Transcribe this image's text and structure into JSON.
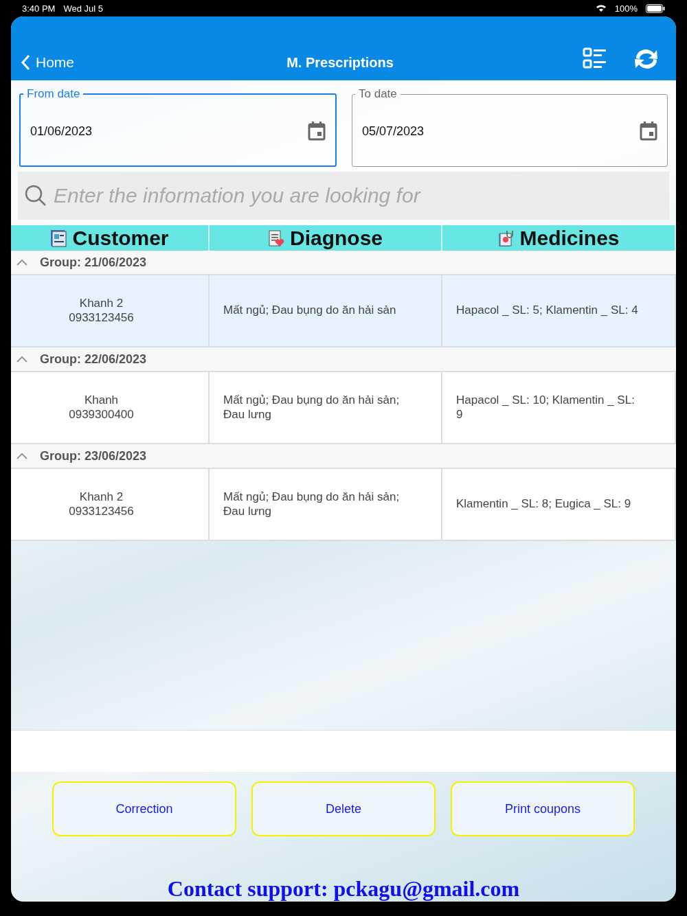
{
  "status_bar": {
    "time": "3:40 PM",
    "date": "Wed Jul 5",
    "battery": "100%"
  },
  "nav": {
    "back": "Home",
    "title": "M. Prescriptions"
  },
  "date_fields": [
    {
      "label": "From date",
      "value": "01/06/2023",
      "focused": true
    },
    {
      "label": "To date",
      "value": "05/07/2023",
      "focused": false
    }
  ],
  "search": {
    "placeholder": "Enter the information you are looking for"
  },
  "table": {
    "columns": [
      {
        "label": "Customer",
        "kind": "customer"
      },
      {
        "label": "Diagnose",
        "kind": "diagnose"
      },
      {
        "label": "Medicines",
        "kind": "medicines"
      }
    ],
    "groups": [
      {
        "label": "Group: 21/06/2023",
        "expanded": true,
        "rows": [
          {
            "selected": true,
            "customer": "Khanh 2",
            "phone": "0933123456",
            "diagnose": "Mất ngủ; Đau bụng do ăn hải sản",
            "medicines": "Hapacol _ SL: 5; Klamentin _ SL: 4"
          }
        ]
      },
      {
        "label": "Group: 22/06/2023",
        "expanded": true,
        "rows": [
          {
            "selected": false,
            "customer": "Khanh",
            "phone": "0939300400",
            "diagnose": "Mất ngủ; Đau bụng do ăn hải sản; Đau lưng",
            "medicines": "Hapacol _ SL: 10; Klamentin _ SL: 9"
          }
        ]
      },
      {
        "label": "Group: 23/06/2023",
        "expanded": true,
        "rows": [
          {
            "selected": false,
            "customer": "Khanh 2",
            "phone": "0933123456",
            "diagnose": "Mất ngủ; Đau bụng do ăn hải sản; Đau lưng",
            "medicines": "Klamentin _ SL: 8; Eugica _ SL: 9"
          }
        ]
      }
    ]
  },
  "buttons": [
    "Correction",
    "Delete",
    "Print coupons"
  ],
  "contact": "Contact support: pckagu@gmail.com"
}
